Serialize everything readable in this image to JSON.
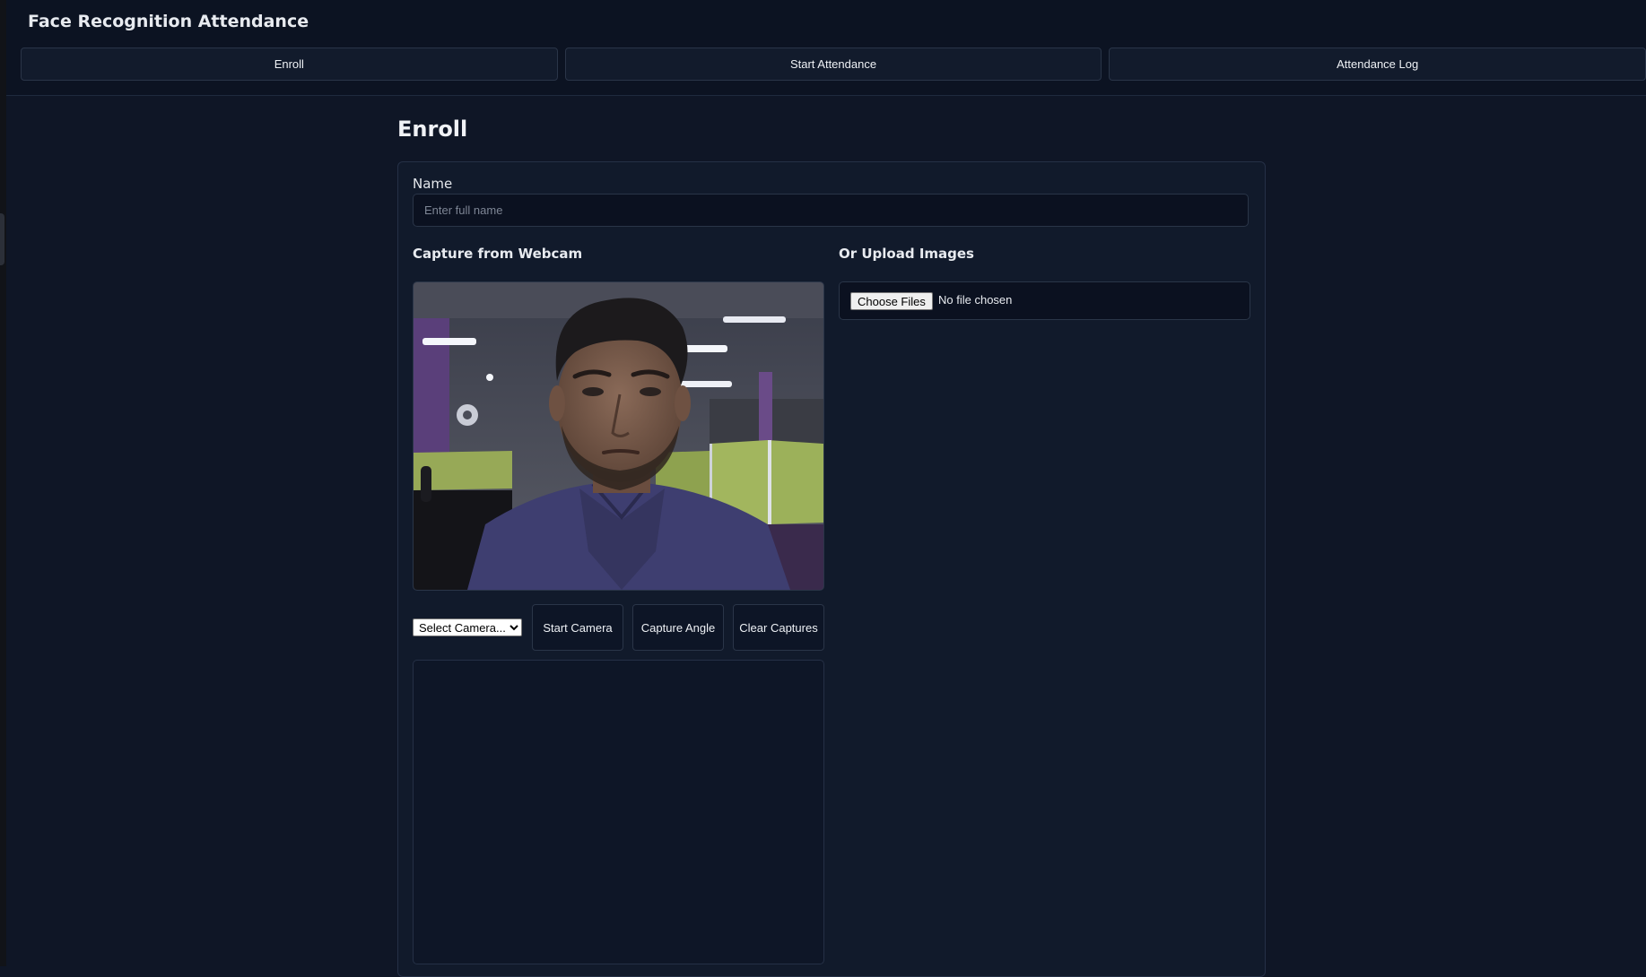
{
  "app": {
    "title": "Face Recognition Attendance"
  },
  "nav": {
    "tabs": [
      {
        "label": "Enroll"
      },
      {
        "label": "Start Attendance"
      },
      {
        "label": "Attendance Log"
      }
    ]
  },
  "page": {
    "title": "Enroll"
  },
  "form": {
    "name_label": "Name",
    "name_placeholder": "Enter full name",
    "name_value": ""
  },
  "webcam": {
    "title": "Capture from Webcam",
    "camera_select_value": "Select Camera...",
    "buttons": {
      "start_camera": "Start Camera",
      "capture_angle": "Capture Angle",
      "clear_captures": "Clear Captures"
    }
  },
  "upload": {
    "title": "Or Upload Images",
    "choose_files_label": "Choose Files",
    "file_status": "No file chosen"
  }
}
